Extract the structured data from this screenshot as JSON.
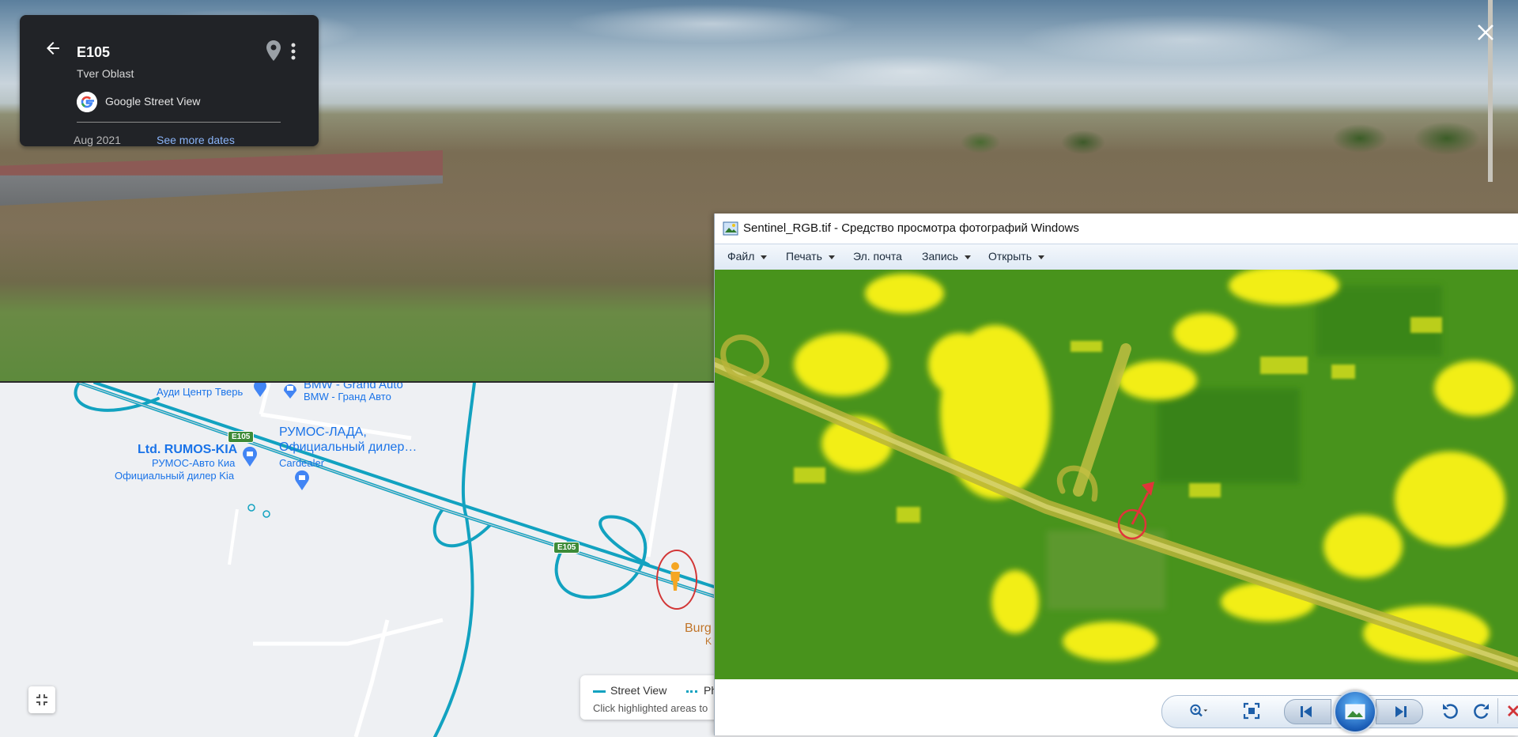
{
  "street_view": {
    "title": "E105",
    "subtitle": "Tver Oblast",
    "provider": "Google Street View",
    "date": "Aug 2021",
    "see_more_dates": "See more dates"
  },
  "map": {
    "labels": {
      "audi": "Ауди Центр Тверь",
      "bmw_en": "BMW - Grand Auto",
      "bmw_ru": "BMW - Гранд Авто",
      "rumos_lada_1": "РУМОС-ЛАДА,",
      "rumos_lada_2": "Официальный дилер…",
      "cardealer": "Cardealer",
      "rumos_kia": "Ltd. RUMOS-KIA",
      "rumos_kia_sub1": "РУМОС-Авто Киа",
      "rumos_kia_sub2": "Официальный дилер Kia",
      "burger": "Burg",
      "burger_sub": "K"
    },
    "road_shields": [
      "E105",
      "E105"
    ],
    "legend": {
      "street_view": "Street View",
      "photos": "Ph",
      "hint": "Click highlighted areas to"
    }
  },
  "viewer": {
    "title": "Sentinel_RGB.tif - Средство просмотра фотографий Windows",
    "menu": [
      {
        "label": "Файл",
        "has_caret": true
      },
      {
        "label": "Печать",
        "has_caret": true
      },
      {
        "label": "Эл. почта",
        "has_caret": false
      },
      {
        "label": "Запись",
        "has_caret": true
      },
      {
        "label": "Открыть",
        "has_caret": true
      }
    ]
  },
  "colors": {
    "info_card_bg": "#212327",
    "link": "#8ab4f8",
    "map_road": "#12a2c0",
    "map_label": "#1a73e8",
    "marker_red": "#d23636",
    "sat_yellow": "#f2ee12",
    "sat_green": "#4f9a1e"
  }
}
